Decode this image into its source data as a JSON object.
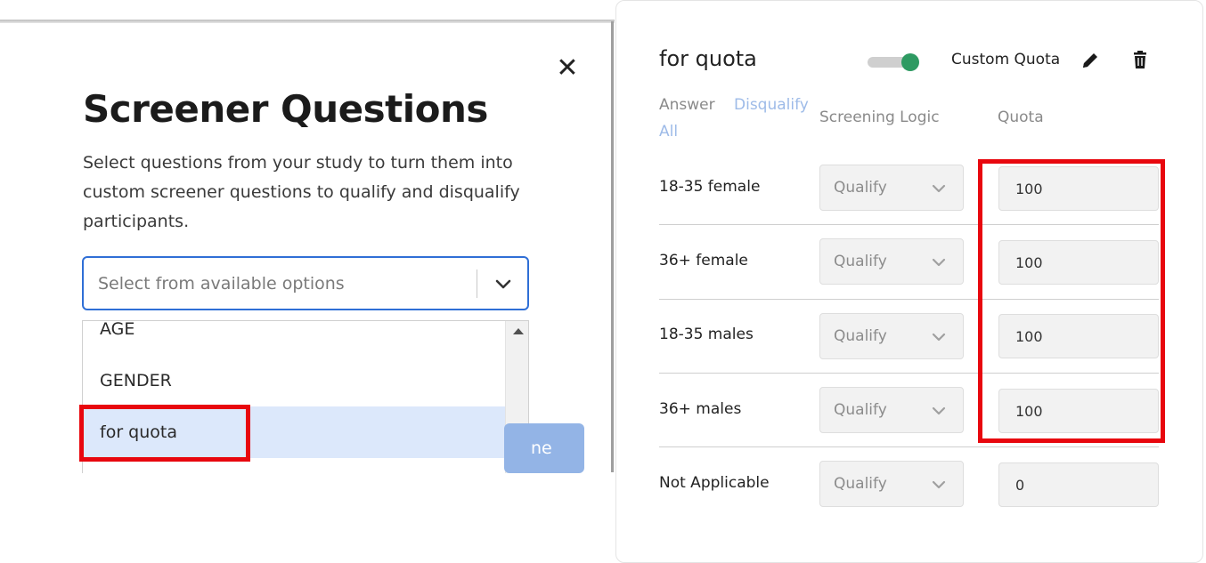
{
  "modal": {
    "close_symbol": "✕",
    "title": "Screener Questions",
    "description": "Select questions from your study to turn them into custom screener questions to qualify and disqualify participants.",
    "select_placeholder": "Select from available options",
    "options": [
      "AGE",
      "GENDER",
      "for quota"
    ],
    "selected_option": "for quota",
    "done_label_fragment": "ne",
    "icons": {
      "close": "close-icon",
      "dropdown": "chevron-down-icon",
      "scroll_up": "scroll-up-arrow-icon"
    }
  },
  "quota_card": {
    "title": "for quota",
    "toggle_on": true,
    "custom_quota_label": "Custom Quota",
    "icons": {
      "edit": "pencil-icon",
      "delete": "trash-icon"
    },
    "headers": {
      "answer": "Answer",
      "disqualify": "Disqualify",
      "all": "All",
      "screening_logic": "Screening Logic",
      "quota": "Quota"
    },
    "rows": [
      {
        "answer": "18-35 female",
        "logic": "Qualify",
        "quota": "100"
      },
      {
        "answer": "36+ female",
        "logic": "Qualify",
        "quota": "100"
      },
      {
        "answer": "18-35 males",
        "logic": "Qualify",
        "quota": "100"
      },
      {
        "answer": "36+ males",
        "logic": "Qualify",
        "quota": "100"
      },
      {
        "answer": "Not Applicable",
        "logic": "Qualify",
        "quota": "0"
      }
    ]
  },
  "colors": {
    "highlight": "#e8070e",
    "primary_blue": "#2f6fd6",
    "selected_row": "#dce8fb",
    "toggle_on": "#2e9a62",
    "link_blue": "#9ebbe8"
  }
}
